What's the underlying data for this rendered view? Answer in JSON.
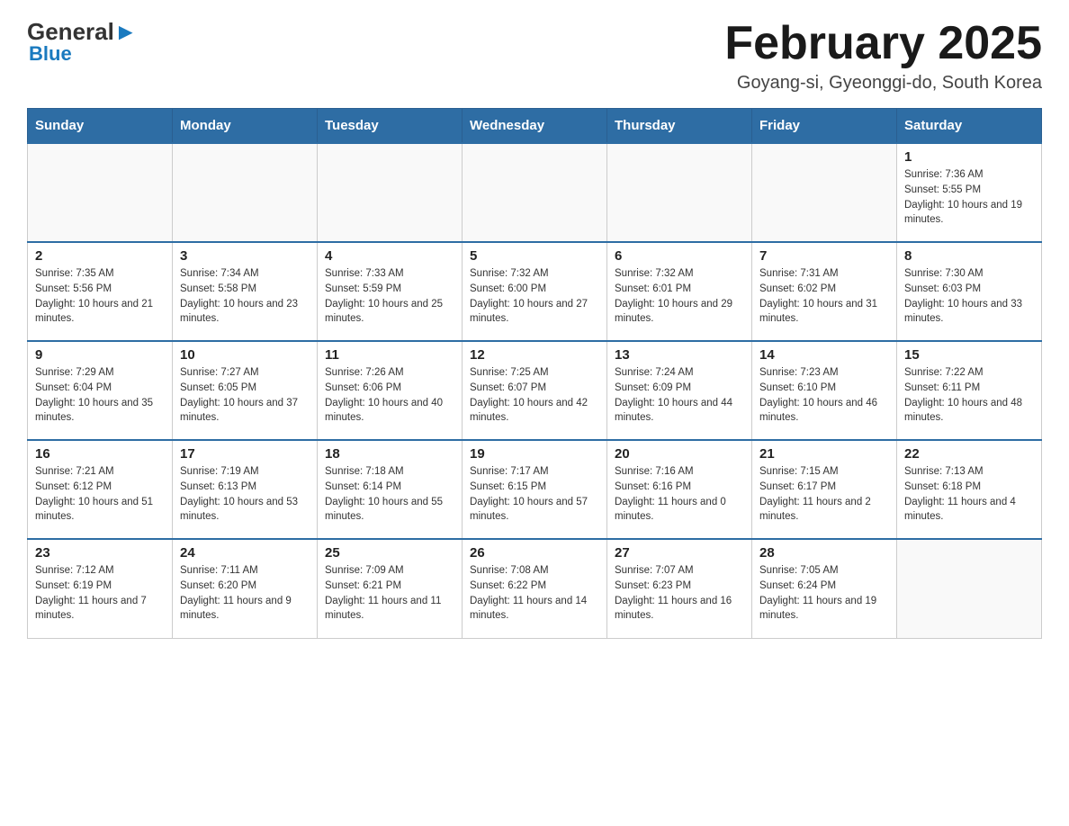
{
  "header": {
    "logo_general": "General",
    "logo_blue": "Blue",
    "month_title": "February 2025",
    "location": "Goyang-si, Gyeonggi-do, South Korea"
  },
  "days_of_week": [
    "Sunday",
    "Monday",
    "Tuesday",
    "Wednesday",
    "Thursday",
    "Friday",
    "Saturday"
  ],
  "weeks": [
    {
      "days": [
        {
          "number": "",
          "info": ""
        },
        {
          "number": "",
          "info": ""
        },
        {
          "number": "",
          "info": ""
        },
        {
          "number": "",
          "info": ""
        },
        {
          "number": "",
          "info": ""
        },
        {
          "number": "",
          "info": ""
        },
        {
          "number": "1",
          "info": "Sunrise: 7:36 AM\nSunset: 5:55 PM\nDaylight: 10 hours and 19 minutes."
        }
      ]
    },
    {
      "days": [
        {
          "number": "2",
          "info": "Sunrise: 7:35 AM\nSunset: 5:56 PM\nDaylight: 10 hours and 21 minutes."
        },
        {
          "number": "3",
          "info": "Sunrise: 7:34 AM\nSunset: 5:58 PM\nDaylight: 10 hours and 23 minutes."
        },
        {
          "number": "4",
          "info": "Sunrise: 7:33 AM\nSunset: 5:59 PM\nDaylight: 10 hours and 25 minutes."
        },
        {
          "number": "5",
          "info": "Sunrise: 7:32 AM\nSunset: 6:00 PM\nDaylight: 10 hours and 27 minutes."
        },
        {
          "number": "6",
          "info": "Sunrise: 7:32 AM\nSunset: 6:01 PM\nDaylight: 10 hours and 29 minutes."
        },
        {
          "number": "7",
          "info": "Sunrise: 7:31 AM\nSunset: 6:02 PM\nDaylight: 10 hours and 31 minutes."
        },
        {
          "number": "8",
          "info": "Sunrise: 7:30 AM\nSunset: 6:03 PM\nDaylight: 10 hours and 33 minutes."
        }
      ]
    },
    {
      "days": [
        {
          "number": "9",
          "info": "Sunrise: 7:29 AM\nSunset: 6:04 PM\nDaylight: 10 hours and 35 minutes."
        },
        {
          "number": "10",
          "info": "Sunrise: 7:27 AM\nSunset: 6:05 PM\nDaylight: 10 hours and 37 minutes."
        },
        {
          "number": "11",
          "info": "Sunrise: 7:26 AM\nSunset: 6:06 PM\nDaylight: 10 hours and 40 minutes."
        },
        {
          "number": "12",
          "info": "Sunrise: 7:25 AM\nSunset: 6:07 PM\nDaylight: 10 hours and 42 minutes."
        },
        {
          "number": "13",
          "info": "Sunrise: 7:24 AM\nSunset: 6:09 PM\nDaylight: 10 hours and 44 minutes."
        },
        {
          "number": "14",
          "info": "Sunrise: 7:23 AM\nSunset: 6:10 PM\nDaylight: 10 hours and 46 minutes."
        },
        {
          "number": "15",
          "info": "Sunrise: 7:22 AM\nSunset: 6:11 PM\nDaylight: 10 hours and 48 minutes."
        }
      ]
    },
    {
      "days": [
        {
          "number": "16",
          "info": "Sunrise: 7:21 AM\nSunset: 6:12 PM\nDaylight: 10 hours and 51 minutes."
        },
        {
          "number": "17",
          "info": "Sunrise: 7:19 AM\nSunset: 6:13 PM\nDaylight: 10 hours and 53 minutes."
        },
        {
          "number": "18",
          "info": "Sunrise: 7:18 AM\nSunset: 6:14 PM\nDaylight: 10 hours and 55 minutes."
        },
        {
          "number": "19",
          "info": "Sunrise: 7:17 AM\nSunset: 6:15 PM\nDaylight: 10 hours and 57 minutes."
        },
        {
          "number": "20",
          "info": "Sunrise: 7:16 AM\nSunset: 6:16 PM\nDaylight: 11 hours and 0 minutes."
        },
        {
          "number": "21",
          "info": "Sunrise: 7:15 AM\nSunset: 6:17 PM\nDaylight: 11 hours and 2 minutes."
        },
        {
          "number": "22",
          "info": "Sunrise: 7:13 AM\nSunset: 6:18 PM\nDaylight: 11 hours and 4 minutes."
        }
      ]
    },
    {
      "days": [
        {
          "number": "23",
          "info": "Sunrise: 7:12 AM\nSunset: 6:19 PM\nDaylight: 11 hours and 7 minutes."
        },
        {
          "number": "24",
          "info": "Sunrise: 7:11 AM\nSunset: 6:20 PM\nDaylight: 11 hours and 9 minutes."
        },
        {
          "number": "25",
          "info": "Sunrise: 7:09 AM\nSunset: 6:21 PM\nDaylight: 11 hours and 11 minutes."
        },
        {
          "number": "26",
          "info": "Sunrise: 7:08 AM\nSunset: 6:22 PM\nDaylight: 11 hours and 14 minutes."
        },
        {
          "number": "27",
          "info": "Sunrise: 7:07 AM\nSunset: 6:23 PM\nDaylight: 11 hours and 16 minutes."
        },
        {
          "number": "28",
          "info": "Sunrise: 7:05 AM\nSunset: 6:24 PM\nDaylight: 11 hours and 19 minutes."
        },
        {
          "number": "",
          "info": ""
        }
      ]
    }
  ]
}
